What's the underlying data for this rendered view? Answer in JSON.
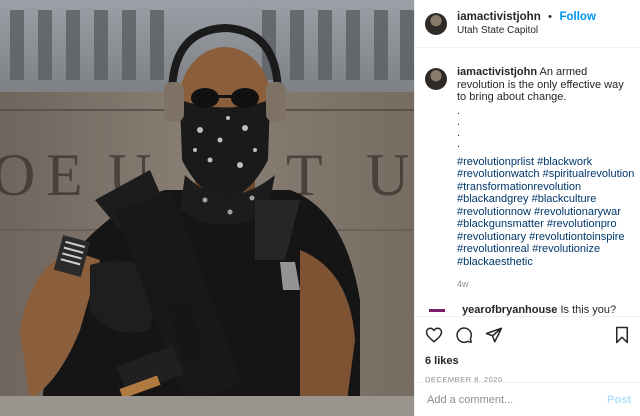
{
  "post": {
    "username": "iamactivistjohn",
    "separator": "•",
    "follow_label": "Follow",
    "location": "Utah State Capitol",
    "photo_wall_letters": [
      "O",
      "E",
      "U",
      "T",
      "U",
      "T"
    ]
  },
  "caption": {
    "username": "iamactivistjohn",
    "text": "An armed revolution is the only effective way to bring about change.",
    "dots": [
      ".",
      ".",
      ".",
      "."
    ],
    "hashtag_lines": [
      "#revolutionprlist #blackwork",
      "#revolutionwatch #spiritualrevolution",
      "#transformationrevolution",
      "#blackandgrey #blackculture",
      "#revolutionnow #revolutionarywar",
      "#blackgunsmatter #revolutionpro",
      "#revolutionary #revolutiontoinspire",
      "#revolutionreal #revolutionize",
      "#blackaesthetic"
    ],
    "time_ago": "4w"
  },
  "next_comment": {
    "username": "yearofbryanhouse",
    "text": "Is this you?"
  },
  "actions": {
    "icons": [
      "heart-icon",
      "comment-icon",
      "share-icon",
      "bookmark-icon"
    ],
    "likes": "6 likes",
    "date": "DECEMBER 8, 2020"
  },
  "add_comment": {
    "placeholder": "Add a comment...",
    "post_label": "Post"
  },
  "colors": {
    "link": "#0095f6",
    "hashtag": "#00376b",
    "muted": "#8e8e8e",
    "post_disabled": "#b2dffc"
  }
}
